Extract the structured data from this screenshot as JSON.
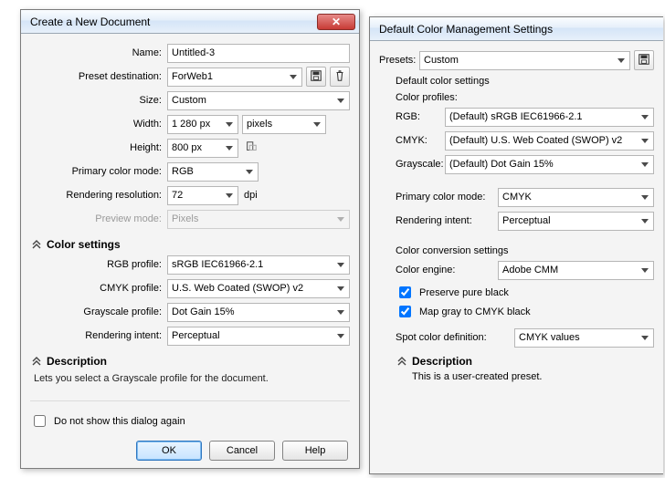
{
  "left": {
    "title": "Create a New Document",
    "labels": {
      "name": "Name:",
      "presetDest": "Preset destination:",
      "size": "Size:",
      "width": "Width:",
      "height": "Height:",
      "primaryColor": "Primary color mode:",
      "renderRes": "Rendering resolution:",
      "previewMode": "Preview mode:",
      "dpi": "dpi"
    },
    "values": {
      "name": "Untitled-3",
      "presetDest": "ForWeb1",
      "size": "Custom",
      "width": "1 280 px",
      "height": "800 px",
      "units": "pixels",
      "primaryColor": "RGB",
      "renderRes": "72",
      "previewMode": "Pixels"
    },
    "colorSection": {
      "title": "Color settings",
      "labels": {
        "rgb": "RGB profile:",
        "cmyk": "CMYK profile:",
        "gray": "Grayscale profile:",
        "intent": "Rendering intent:"
      },
      "values": {
        "rgb": "sRGB IEC61966-2.1",
        "cmyk": "U.S. Web Coated (SWOP) v2",
        "gray": "Dot Gain 15%",
        "intent": "Perceptual"
      }
    },
    "description": {
      "title": "Description",
      "text": "Lets you select a Grayscale profile for the document."
    },
    "footer": {
      "dontShow": "Do not show this dialog again",
      "ok": "OK",
      "cancel": "Cancel",
      "help": "Help"
    }
  },
  "right": {
    "title": "Default Color Management Settings",
    "presetsLabel": "Presets:",
    "presetsValue": "Custom",
    "defaultColorSettings": "Default color settings",
    "colorProfiles": {
      "title": "Color profiles:",
      "rgbLabel": "RGB:",
      "rgbValue": "(Default) sRGB IEC61966-2.1",
      "cmykLabel": "CMYK:",
      "cmykValue": "(Default) U.S. Web Coated (SWOP) v2",
      "grayLabel": "Grayscale:",
      "grayValue": "(Default) Dot Gain 15%"
    },
    "primaryColor": {
      "label": "Primary color mode:",
      "value": "CMYK"
    },
    "renderIntent": {
      "label": "Rendering intent:",
      "value": "Perceptual"
    },
    "conversion": {
      "title": "Color conversion settings",
      "engineLabel": "Color engine:",
      "engineValue": "Adobe CMM",
      "preserveBlack": "Preserve pure black",
      "mapGray": "Map gray to CMYK black"
    },
    "spot": {
      "label": "Spot color definition:",
      "value": "CMYK values"
    },
    "description": {
      "title": "Description",
      "text": "This is a user-created preset."
    }
  }
}
